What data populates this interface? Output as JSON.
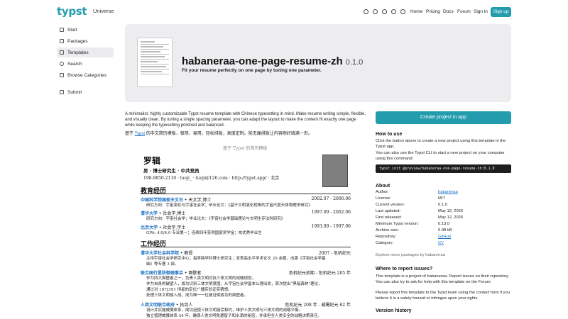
{
  "header": {
    "logo": "typst",
    "universe": "Universe",
    "nav": [
      "Home",
      "Pricing",
      "Docs",
      "Forum",
      "Sign in"
    ],
    "signup": "Sign up"
  },
  "sidebar": {
    "items": [
      {
        "label": "Start",
        "icon": "home-icon"
      },
      {
        "label": "Packages",
        "icon": "package-icon"
      },
      {
        "label": "Templates",
        "icon": "template-icon"
      },
      {
        "label": "Search",
        "icon": "search-icon"
      },
      {
        "label": "Browse Categories",
        "icon": "categories-icon"
      },
      {
        "label": "Submit",
        "icon": "submit-icon"
      }
    ]
  },
  "hero": {
    "title": "habaneraa-one-page-resume-zh",
    "version": "0.1.0",
    "subtitle": "Fit your resume perfectly on one page by tuning one parameter."
  },
  "description": {
    "en": "A minimalist, highly customizable Typst resume template with Chinese typesetting in mind. Make resume writing simple, flexible, and visually clean. By tuning a single spacing parameter, you can adapt the layout to make the content fit exactly one page while keeping the typesetting polished and balanced.",
    "zh_prefix": "基于",
    "zh_link": "Typst",
    "zh_rest": "的中文简历模板，极简，易用，轻松排版，高度定制。能无痛排版让内容刚好填满一页。"
  },
  "preview": {
    "caption": "基于 Typst 的简历模板",
    "name": "罗辑",
    "role": "男 · 博士研究生 · 中共党员",
    "contact": "198-9850-2110 · luoji_ · luoji@126.com · http://typst.app/ · 北京",
    "sections": {
      "edu": "教育经历",
      "work": "工作经历"
    },
    "edu": [
      {
        "org": "中国科学院国家天文台",
        "title": " • 天文学,博士",
        "date": "2002.07 - 2006.06",
        "bullets": [
          "研究方向：宇宙演化与宇宙社会学；毕业论文：《基于文明演化视角的宇宙尺度天体物理学研究》"
        ]
      },
      {
        "org": "清华大学",
        "title": " • 社会学,博士",
        "date": "1997.09 - 2002.06",
        "bullets": [
          "研究方向：宇宙社会学；毕业论文：《宇宙社会学基础理论与文明生存法则研究》"
        ]
      },
      {
        "org": "北京大学",
        "title": " • 社会学,学士",
        "date": "1993.09 - 1997.06",
        "bullets": [
          "GPA: 4.0/4.0 专业第一；连续四年获得国家奖学金；校优秀毕业生"
        ]
      }
    ],
    "work": [
      {
        "org": "清华大学社会科学院",
        "title": " • 教授",
        "date": "2007 - 危机纪元",
        "bullets": [
          "主持宇宙社会学研究中心；指导跨学科博士研究生；发表高水平学术论文 20 余篇，出版《宇宙社会学基",
          "础》等专著 3 部。"
        ]
      },
      {
        "org": "联合国行星防御理事会",
        "title": " • 面壁者",
        "date": "危机纪元初期 - 危机纪元 205 年",
        "bullets": [
          "作为四大面壁者之一，负责人类文明对抗三体文明的战略规划。",
          "作为自身的破壁人，成功识别三体文明意图，从宇宙社会学基本公理出发，首次提出“黑暗森林”理论，",
          "通过对 187J3X1 恒星的定位广播实验证实猜想。",
          "处理三体文明侵入战，成为唯一一位被证明成功的面壁者。"
        ]
      },
      {
        "org": "人类文明联合政府",
        "title": " • 执剑人",
        "date": "危机纪元 208 年 - 威慑纪元 62 年",
        "bullets": [
          "设计并实施威慑体系，成功迫使三体文明接受和约，维护人类文明与三体文明的战略平衡。",
          "独立管理威慑体系 54 年，确保人类文明免遭智子和水滴的秘密，并承担全人类安全的战略决策责任。"
        ]
      }
    ]
  },
  "right": {
    "cta": "Create project in app",
    "how_title": "How to use",
    "how_p1": "Click the button above to create a new project using this template in the Typst app.",
    "how_p2": "You can also use the Typst CLI to start a new project on your computer using this command:",
    "command": "typst init @preview/habaneraa-one-page-resume-zh:0.1.0",
    "about_title": "About",
    "about": [
      {
        "k": "Author:",
        "v": "habaneraa",
        "link": true
      },
      {
        "k": "License:",
        "v": "MIT"
      },
      {
        "k": "Current version:",
        "v": "0.1.0"
      },
      {
        "k": "Last updated:",
        "v": "May 12, 2026"
      },
      {
        "k": "First released:",
        "v": "May 12, 2026"
      },
      {
        "k": "Minimum Typst version:",
        "v": "0.13.0"
      },
      {
        "k": "Archive size:",
        "v": "5.98 kB"
      },
      {
        "k": "Repository:",
        "v": "GitHub",
        "link": true
      },
      {
        "k": "Category:",
        "v": "CV",
        "link": true
      }
    ],
    "explore": "Explore more packages by habaneraa",
    "report_title": "Where to report issues?",
    "report_p1": "This template is a project of habaneraa. Report issues on their repository. You can also try to ask for help with this template on the Forum.",
    "report_p2": "Please report this template to the Typst team using the contact form if you believe it is a safety hazard or infringes upon your rights.",
    "history_title": "Version history"
  }
}
